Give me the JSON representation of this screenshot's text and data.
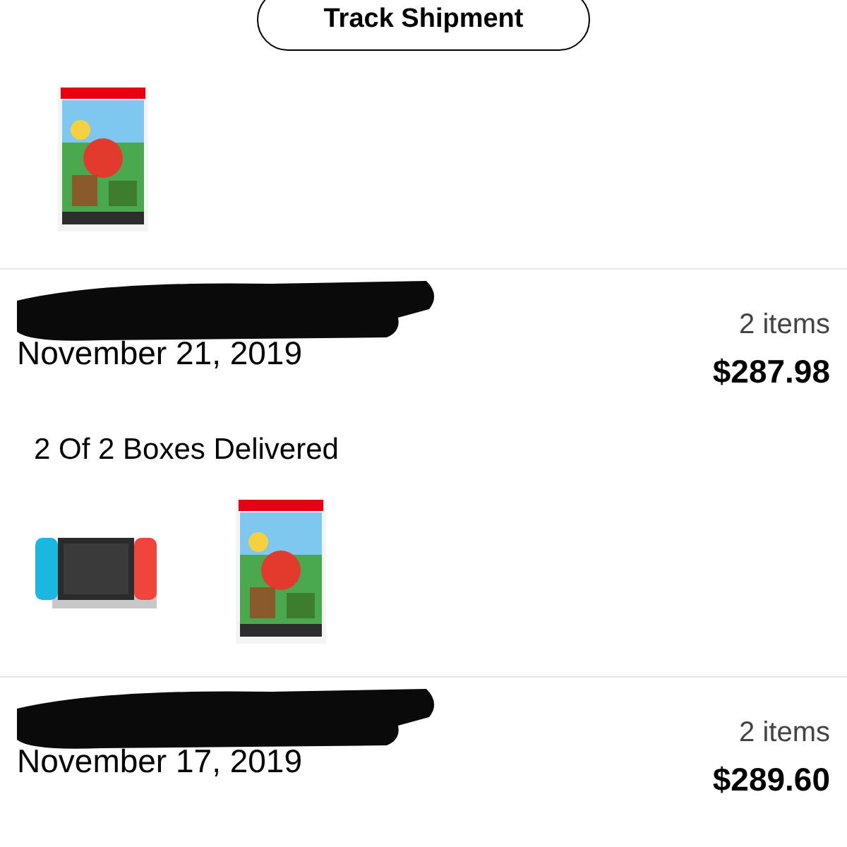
{
  "top": {
    "button": "Track Shipment"
  },
  "orders": [
    {
      "count": "2 items",
      "date": "November 21, 2019",
      "total": "$287.98",
      "status": "2 Of 2 Boxes Delivered"
    },
    {
      "count": "2 items",
      "date": "November 17, 2019",
      "total": "$289.60"
    }
  ]
}
